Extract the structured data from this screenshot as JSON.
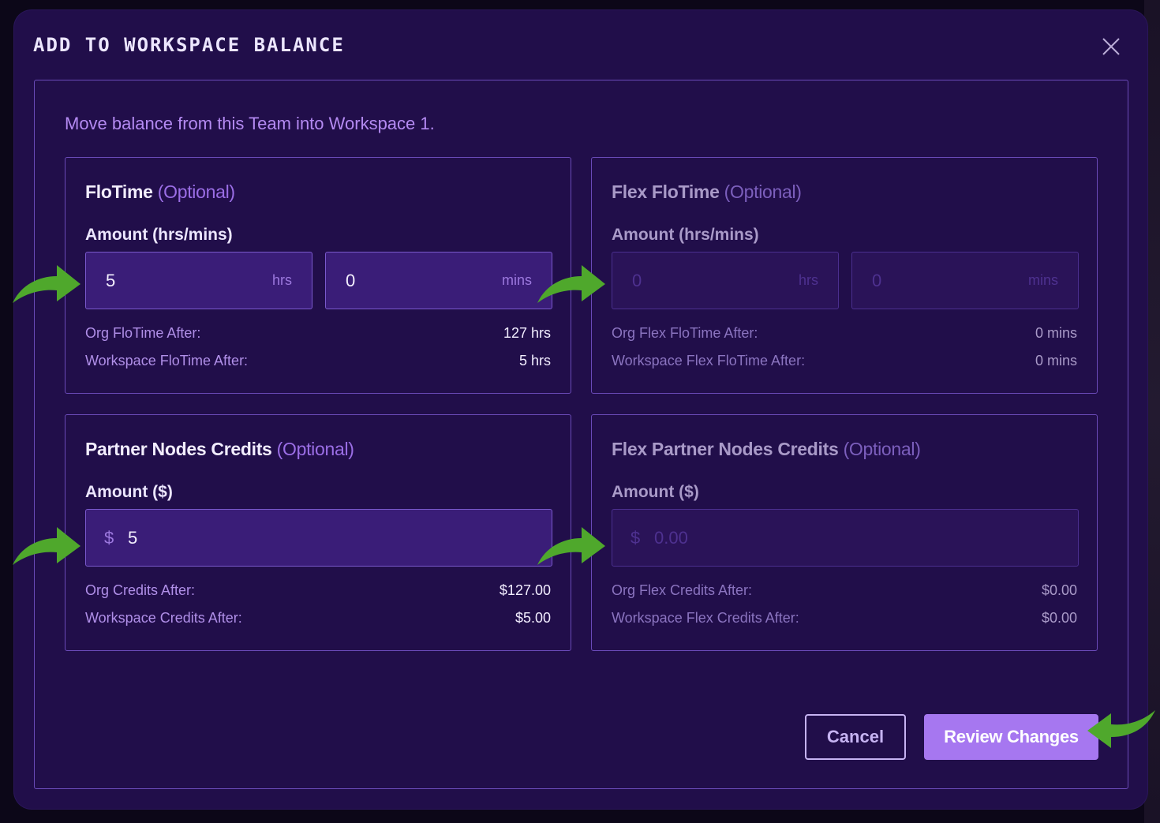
{
  "modal": {
    "title": "ADD TO WORKSPACE BALANCE",
    "intro": "Move balance from this Team into Workspace 1."
  },
  "flotime": {
    "title": "FloTime",
    "optional": "(Optional)",
    "amount_label": "Amount (hrs/mins)",
    "hrs_value": "5",
    "hrs_unit": "hrs",
    "mins_value": "0",
    "mins_unit": "mins",
    "org_label": "Org FloTime After:",
    "org_value": "127 hrs",
    "ws_label": "Workspace FloTime After:",
    "ws_value": "5 hrs"
  },
  "flex_flotime": {
    "title": "Flex FloTime",
    "optional": "(Optional)",
    "amount_label": "Amount (hrs/mins)",
    "hrs_placeholder": "0",
    "hrs_unit": "hrs",
    "mins_placeholder": "0",
    "mins_unit": "mins",
    "org_label": "Org Flex FloTime After:",
    "org_value": "0 mins",
    "ws_label": "Workspace Flex FloTime After:",
    "ws_value": "0 mins"
  },
  "credits": {
    "title": "Partner Nodes Credits",
    "optional": "(Optional)",
    "amount_label": "Amount ($)",
    "currency": "$",
    "value": "5",
    "org_label": "Org Credits After:",
    "org_value": "$127.00",
    "ws_label": "Workspace Credits After:",
    "ws_value": "$5.00"
  },
  "flex_credits": {
    "title": "Flex Partner Nodes Credits",
    "optional": "(Optional)",
    "amount_label": "Amount ($)",
    "currency": "$",
    "placeholder": "0.00",
    "org_label": "Org Flex Credits After:",
    "org_value": "$0.00",
    "ws_label": "Workspace Flex Credits After:",
    "ws_value": "$0.00"
  },
  "buttons": {
    "cancel": "Cancel",
    "review": "Review Changes"
  },
  "colors": {
    "modal_bg": "#210e4a",
    "accent": "#a677f0",
    "annotation_arrow": "#4fa82c"
  },
  "icons": [
    "close-icon",
    "annotation-arrow-icon"
  ]
}
